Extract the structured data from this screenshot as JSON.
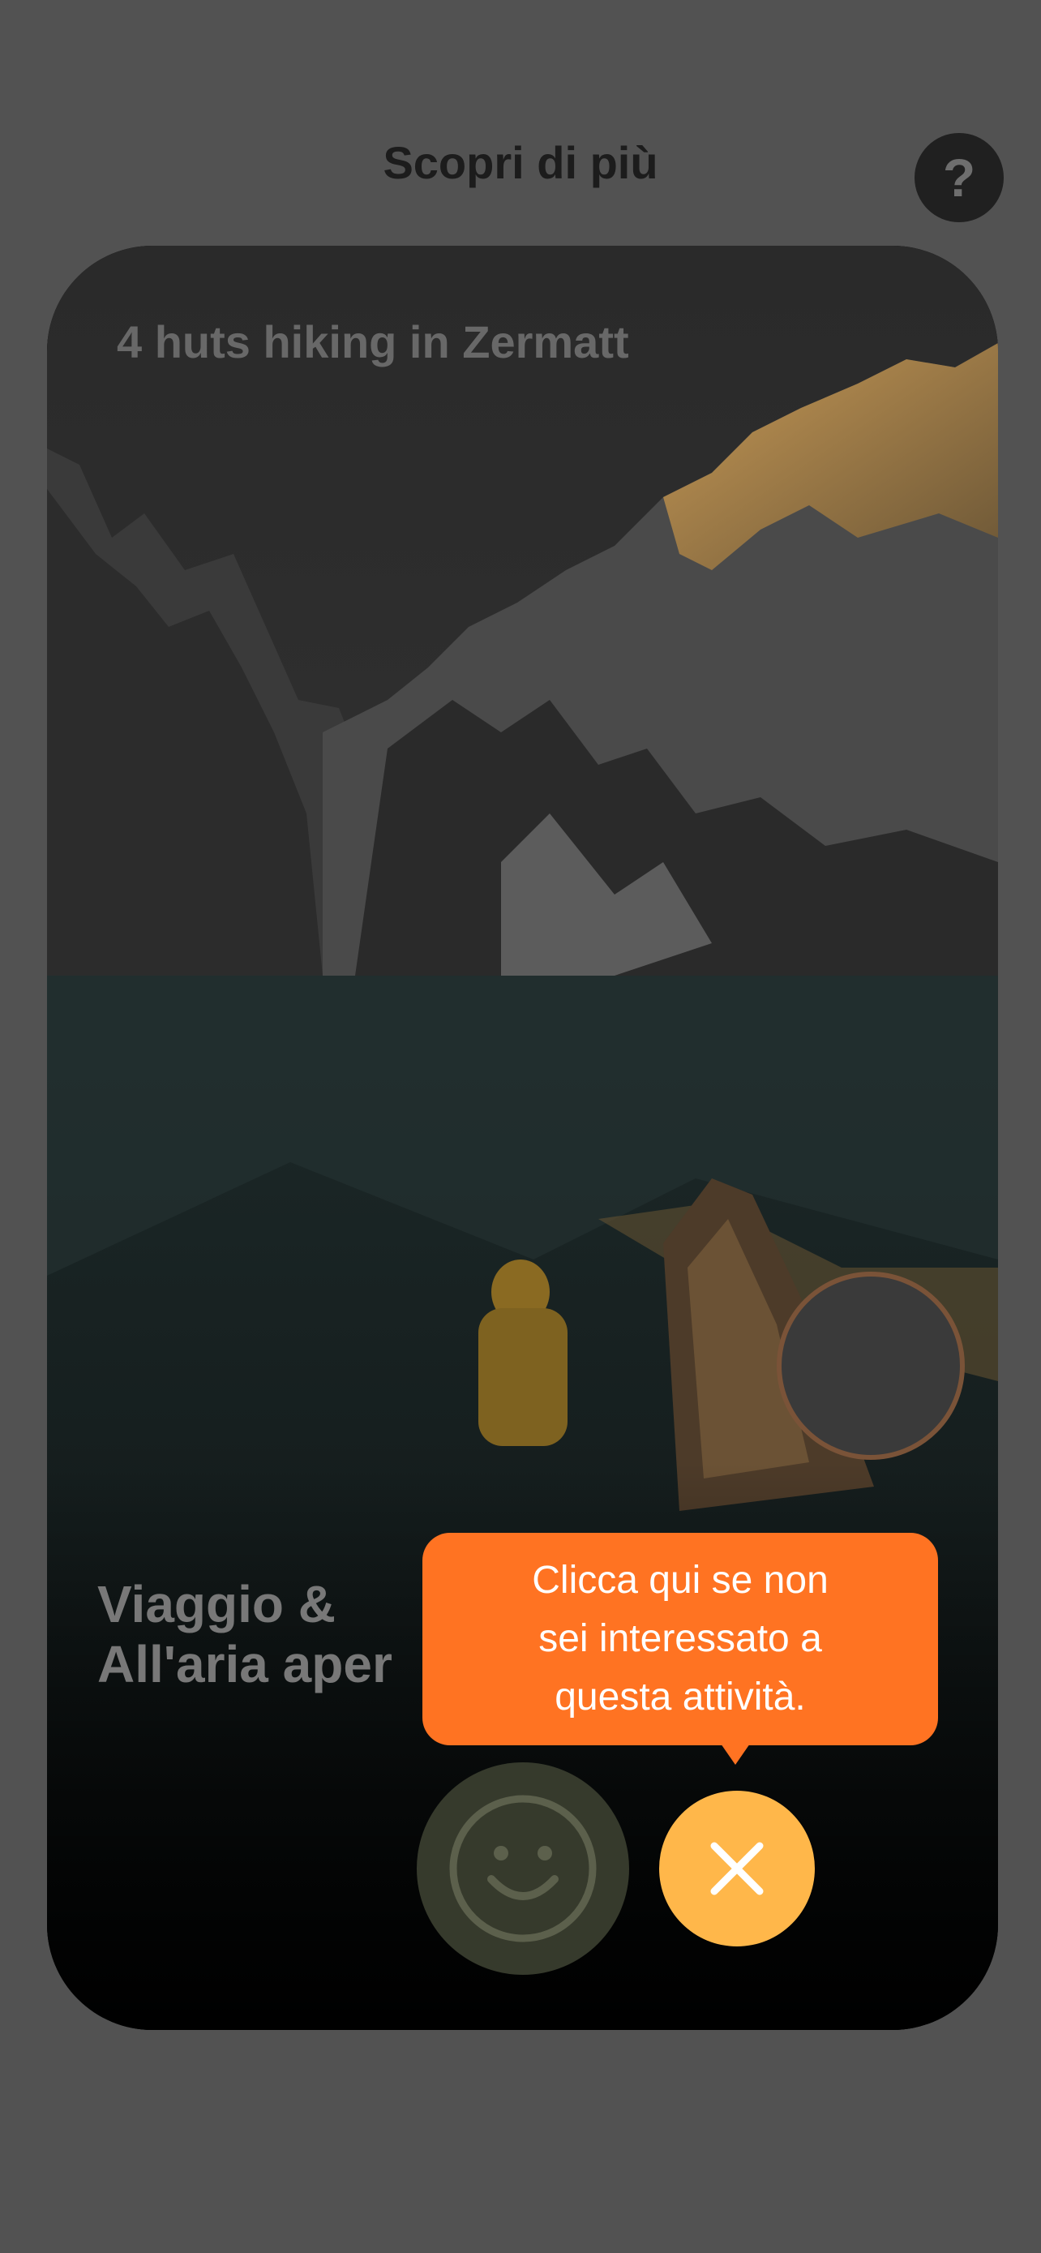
{
  "header": {
    "title": "Scopri di più",
    "help_label": "?"
  },
  "card": {
    "title": "4 huts hiking in Zermatt",
    "category_line1": "Viaggio &",
    "category_line2": "All'aria aper"
  },
  "actions": {
    "like_icon": "smiley-face-icon",
    "dislike_icon": "close-x-icon"
  },
  "tooltip": {
    "line1": "Clicca qui se non",
    "line2": "sei interessato a",
    "line3": "questa attività."
  },
  "colors": {
    "overlay": "#525252",
    "tooltip_bg": "#ff7322",
    "dislike_bg": "#ffb74a",
    "like_bg": "#363a2c"
  }
}
